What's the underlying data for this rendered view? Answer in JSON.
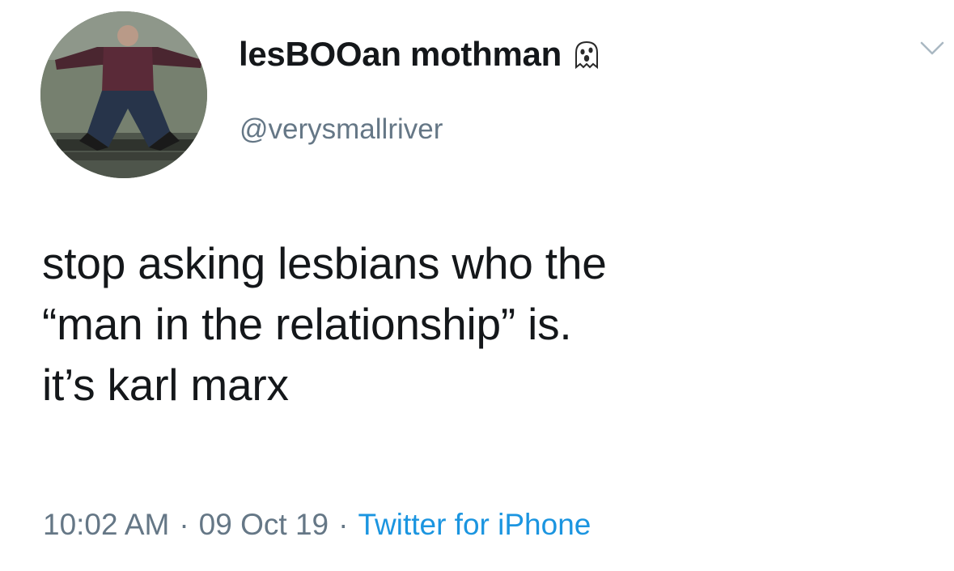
{
  "user": {
    "display_name": "lesBOOan mothman",
    "handle": "@verysmallriver",
    "name_emoji_icon": "ghost-icon"
  },
  "menu": {
    "icon": "chevron-down-icon"
  },
  "tweet": {
    "text_lines": [
      "stop asking lesbians who the",
      "“man in the relationship” is.",
      "it’s karl marx"
    ],
    "time": "10:02 AM",
    "separator": "·",
    "date": "09 Oct 19",
    "source": "Twitter for iPhone"
  },
  "colors": {
    "text": "#14171a",
    "secondary": "#657786",
    "link": "#1b95e0"
  }
}
